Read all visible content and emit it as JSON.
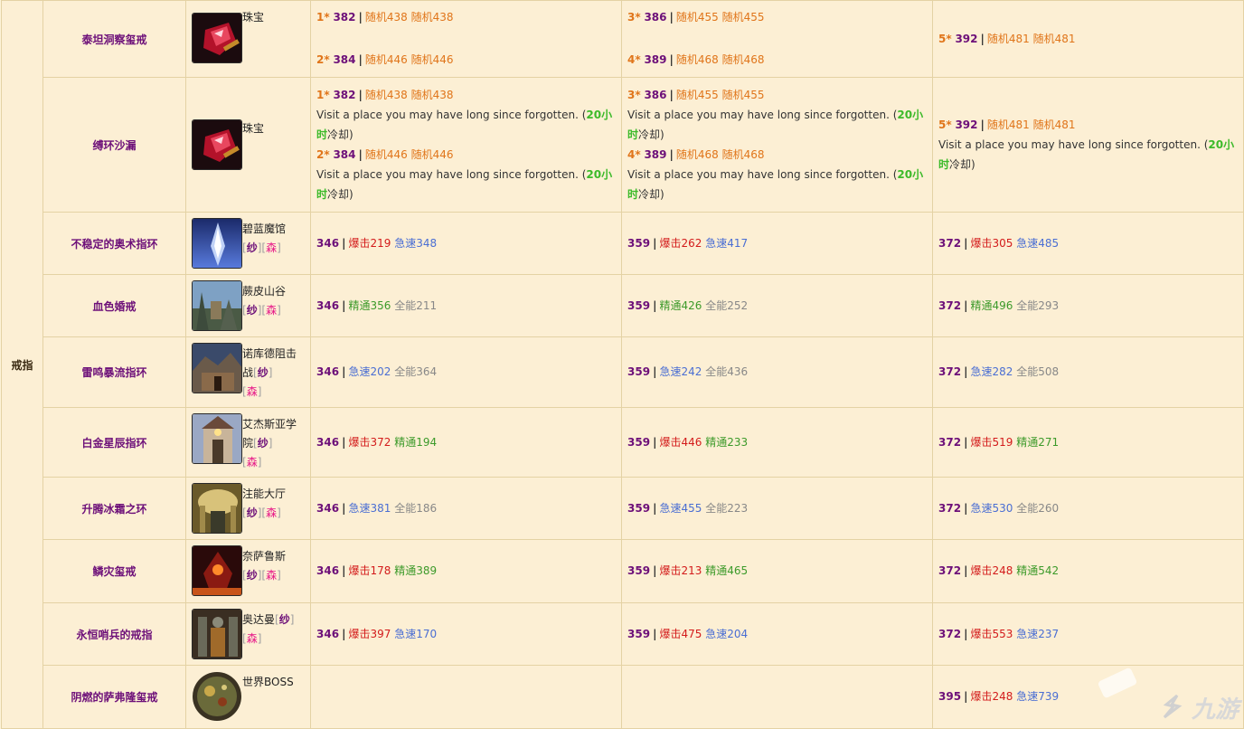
{
  "category": "戒指",
  "rows": [
    {
      "name": "泰坦洞察玺戒",
      "source": "珠宝",
      "tags": [],
      "icon": "ruby-jewel-icon",
      "c1": {
        "a_star": "1*",
        "a_ilvl": "382",
        "a_s1": "随机438",
        "a_s2": "随机438",
        "b_star": "2*",
        "b_ilvl": "384",
        "b_s1": "随机446",
        "b_s2": "随机446"
      },
      "c2": {
        "a_star": "3*",
        "a_ilvl": "386",
        "a_s1": "随机455",
        "a_s2": "随机455",
        "b_star": "4*",
        "b_ilvl": "389",
        "b_s1": "随机468",
        "b_s2": "随机468"
      },
      "c3": {
        "a_star": "5*",
        "a_ilvl": "392",
        "a_s1": "随机481",
        "a_s2": "随机481"
      }
    },
    {
      "name": "缚环沙漏",
      "source": "珠宝",
      "tags": [],
      "icon": "ruby-jewel-icon",
      "note": "Visit a place you may have long since forgotten. (",
      "cd_a": "20小",
      "cd_b": "时",
      "cd_suffix": "冷却)",
      "c1": {
        "a_star": "1*",
        "a_ilvl": "382",
        "a_s1": "随机438",
        "a_s2": "随机438",
        "b_star": "2*",
        "b_ilvl": "384",
        "b_s1": "随机446",
        "b_s2": "随机446"
      },
      "c2": {
        "a_star": "3*",
        "a_ilvl": "386",
        "a_s1": "随机455",
        "a_s2": "随机455",
        "b_star": "4*",
        "b_ilvl": "389",
        "b_s1": "随机468",
        "b_s2": "随机468"
      },
      "c3": {
        "a_star": "5*",
        "a_ilvl": "392",
        "a_s1": "随机481",
        "a_s2": "随机481"
      }
    },
    {
      "name": "不稳定的奥术指环",
      "source": "碧蓝魔馆",
      "tag1": "纱",
      "tag2": "森",
      "icon": "azure-vault-icon",
      "c1": {
        "ilvl": "346",
        "s1": "爆击219",
        "s2": "急速348"
      },
      "c2": {
        "ilvl": "359",
        "s1": "爆击262",
        "s2": "急速417"
      },
      "c3": {
        "ilvl": "372",
        "s1": "爆击305",
        "s2": "急速485"
      }
    },
    {
      "name": "血色婚戒",
      "source": "蕨皮山谷",
      "tag1": "纱",
      "tag2": "森",
      "icon": "brackenhide-icon",
      "c1": {
        "ilvl": "346",
        "s1": "精通356",
        "s2": "全能211"
      },
      "c2": {
        "ilvl": "359",
        "s1": "精通426",
        "s2": "全能252"
      },
      "c3": {
        "ilvl": "372",
        "s1": "精通496",
        "s2": "全能293"
      }
    },
    {
      "name": "雷鸣暴流指环",
      "source1": "诺库德阻击",
      "source2": "战",
      "tag1": "纱",
      "tag2": "森",
      "icon": "nokhud-icon",
      "c1": {
        "ilvl": "346",
        "s1": "急速202",
        "s2": "全能364"
      },
      "c2": {
        "ilvl": "359",
        "s1": "急速242",
        "s2": "全能436"
      },
      "c3": {
        "ilvl": "372",
        "s1": "急速282",
        "s2": "全能508"
      }
    },
    {
      "name": "白金星辰指环",
      "source1": "艾杰斯亚学",
      "source2": "院",
      "tag1": "纱",
      "tag2": "森",
      "icon": "academy-icon",
      "c1": {
        "ilvl": "346",
        "s1": "爆击372",
        "s2": "精通194"
      },
      "c2": {
        "ilvl": "359",
        "s1": "爆击446",
        "s2": "精通233"
      },
      "c3": {
        "ilvl": "372",
        "s1": "爆击519",
        "s2": "精通271"
      }
    },
    {
      "name": "升腾冰霜之环",
      "source": "注能大厅",
      "tag1": "纱",
      "tag2": "森",
      "icon": "halls-infusion-icon",
      "c1": {
        "ilvl": "346",
        "s1": "急速381",
        "s2": "全能186"
      },
      "c2": {
        "ilvl": "359",
        "s1": "急速455",
        "s2": "全能223"
      },
      "c3": {
        "ilvl": "372",
        "s1": "急速530",
        "s2": "全能260"
      }
    },
    {
      "name": "鳞灾玺戒",
      "source": "奈萨鲁斯",
      "tag1": "纱",
      "tag2": "森",
      "icon": "neltharus-icon",
      "c1": {
        "ilvl": "346",
        "s1": "爆击178",
        "s2": "精通389"
      },
      "c2": {
        "ilvl": "359",
        "s1": "爆击213",
        "s2": "精通465"
      },
      "c3": {
        "ilvl": "372",
        "s1": "爆击248",
        "s2": "精通542"
      }
    },
    {
      "name": "永恒哨兵的戒指",
      "source": "奥达曼",
      "tag1": "纱",
      "tag2": "森",
      "icon": "uldaman-icon",
      "c1": {
        "ilvl": "346",
        "s1": "爆击397",
        "s2": "急速170"
      },
      "c2": {
        "ilvl": "359",
        "s1": "爆击475",
        "s2": "急速204"
      },
      "c3": {
        "ilvl": "372",
        "s1": "爆击553",
        "s2": "急速237"
      }
    },
    {
      "name": "阴燃的萨弗隆玺戒",
      "source": "世界BOSS",
      "icon": "world-boss-icon",
      "c3": {
        "ilvl": "395",
        "s1": "爆击248",
        "s2": "急速739"
      }
    }
  ],
  "watermark": "九游",
  "colors": {
    "bg": "#fcefd4",
    "border": "#e4d2a4",
    "name": "#6d1079",
    "crit": "#d31b1b",
    "haste": "#4a6ed3",
    "mastery": "#3c9a2a",
    "vers": "#888888",
    "random": "#e0751a"
  }
}
